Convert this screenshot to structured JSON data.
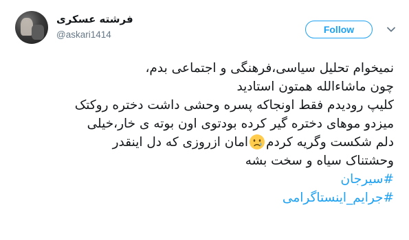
{
  "user": {
    "display_name": "فرشته عسکری",
    "handle": "@askari1414"
  },
  "follow_button": {
    "label": "Follow"
  },
  "icons": {
    "menu": "chevron-down-icon",
    "emoji": "crying-face-emoji"
  },
  "tweet": {
    "line1": "نمیخوام تحلیل سیاسی،فرهنگی و اجتماعی بدم،",
    "line2": "چون ماشاءالله همتون استادید",
    "line3": "کلیپ رودیدم فقط اونجاکه پسره  وحشی داشت دختره روکتک",
    "line4": "میزدو موهای دختره گیر کرده بودتوی اون بوته ی خار،خیلی",
    "line5_before": "دلم شکست وگریه کردم",
    "line5_after": "امان ازروزی که دل اینقدر",
    "line6": "وحشتناک سیاه و سخت بشه",
    "hashtags": [
      "#سیرجان",
      "#جرایم_اینستاگرامی"
    ]
  },
  "colors": {
    "accent": "#1da1f2",
    "text": "#14171a",
    "muted": "#657786"
  }
}
